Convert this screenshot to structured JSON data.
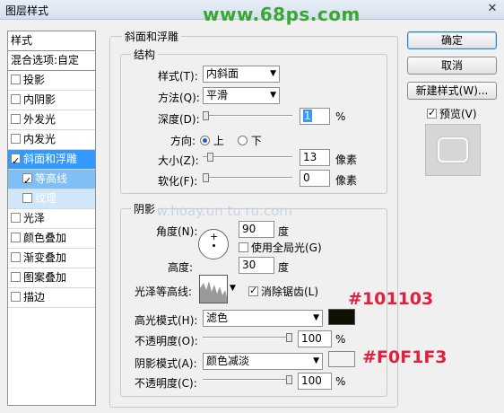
{
  "window": {
    "title": "图层样式",
    "close_glyph": "✕"
  },
  "watermark": "www.68ps.com",
  "watermark2": "www.hoay.un tu ru.com",
  "styles_panel": {
    "header": "样式",
    "blend_options": "混合选项:自定",
    "items": [
      {
        "label": "投影",
        "checked": false
      },
      {
        "label": "内阴影",
        "checked": false
      },
      {
        "label": "外发光",
        "checked": false
      },
      {
        "label": "内发光",
        "checked": false
      },
      {
        "label": "斜面和浮雕",
        "checked": true
      },
      {
        "label": "等高线",
        "checked": true
      },
      {
        "label": "纹理",
        "checked": false
      },
      {
        "label": "光泽",
        "checked": false
      },
      {
        "label": "颜色叠加",
        "checked": false
      },
      {
        "label": "渐变叠加",
        "checked": false
      },
      {
        "label": "图案叠加",
        "checked": false
      },
      {
        "label": "描边",
        "checked": false
      }
    ]
  },
  "bevel": {
    "title": "斜面和浮雕",
    "structure": {
      "title": "结构",
      "style_label": "样式(T):",
      "style_value": "内斜面",
      "technique_label": "方法(Q):",
      "technique_value": "平滑",
      "depth_label": "深度(D):",
      "depth_value": "1",
      "depth_unit": "%",
      "depth_level": 0.0,
      "direction_label": "方向:",
      "dir_up": "上",
      "dir_down": "下",
      "size_label": "大小(Z):",
      "size_value": "13",
      "size_unit": "像素",
      "size_level": 0.05,
      "soften_label": "软化(F):",
      "soften_value": "0",
      "soften_unit": "像素",
      "soften_level": 0.0
    },
    "shading": {
      "title": "阴影",
      "angle_label": "角度(N):",
      "angle_value": "90",
      "angle_unit": "度",
      "global_light_label": "使用全局光(G)",
      "altitude_label": "高度:",
      "altitude_value": "30",
      "altitude_unit": "度",
      "gloss_contour_label": "光泽等高线:",
      "antialias_label": "消除锯齿(L)",
      "highlight_mode_label": "高光模式(H):",
      "highlight_mode_value": "滤色",
      "highlight_color": "#101103",
      "highlight_opacity_label": "不透明度(O):",
      "highlight_opacity_value": "100",
      "highlight_opacity_unit": "%",
      "shadow_mode_label": "阴影模式(A):",
      "shadow_mode_value": "颜色减淡",
      "shadow_color": "#F0F1F3",
      "shadow_opacity_label": "不透明度(C):",
      "shadow_opacity_value": "100",
      "shadow_opacity_unit": "%"
    }
  },
  "buttons": {
    "ok": "确定",
    "cancel": "取消",
    "new_style": "新建样式(W)...",
    "preview_label": "预览(V)"
  },
  "annotations": {
    "highlight_hex": "#101103",
    "shadow_hex": "#F0F1F3"
  }
}
